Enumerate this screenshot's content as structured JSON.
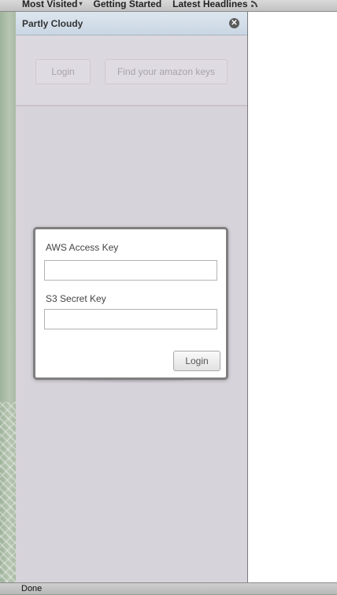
{
  "bookmarks_toolbar": {
    "items": [
      {
        "label": "Most Visited",
        "icon": "dropdown-caret-icon"
      },
      {
        "label": "Getting Started"
      },
      {
        "label": "Latest Headlines",
        "icon": "rss-icon"
      }
    ]
  },
  "sidebar": {
    "title": "Partly Cloudy",
    "close_icon": "close-circle-icon",
    "top_buttons": {
      "login_label": "Login",
      "find_keys_label": "Find your amazon keys"
    },
    "illustration": "cloud-globe-illustration"
  },
  "login_dialog": {
    "access_key_label": "AWS Access Key",
    "access_key_value": "",
    "secret_key_label": "S3 Secret Key",
    "secret_key_value": "",
    "login_button_label": "Login"
  },
  "status_bar": {
    "text": "Done"
  },
  "colors": {
    "sidebar_background": "#d7d3da",
    "header_background": "#c9d6e3",
    "dialog_border": "#7f7f7f",
    "globe": "#6f7397"
  }
}
